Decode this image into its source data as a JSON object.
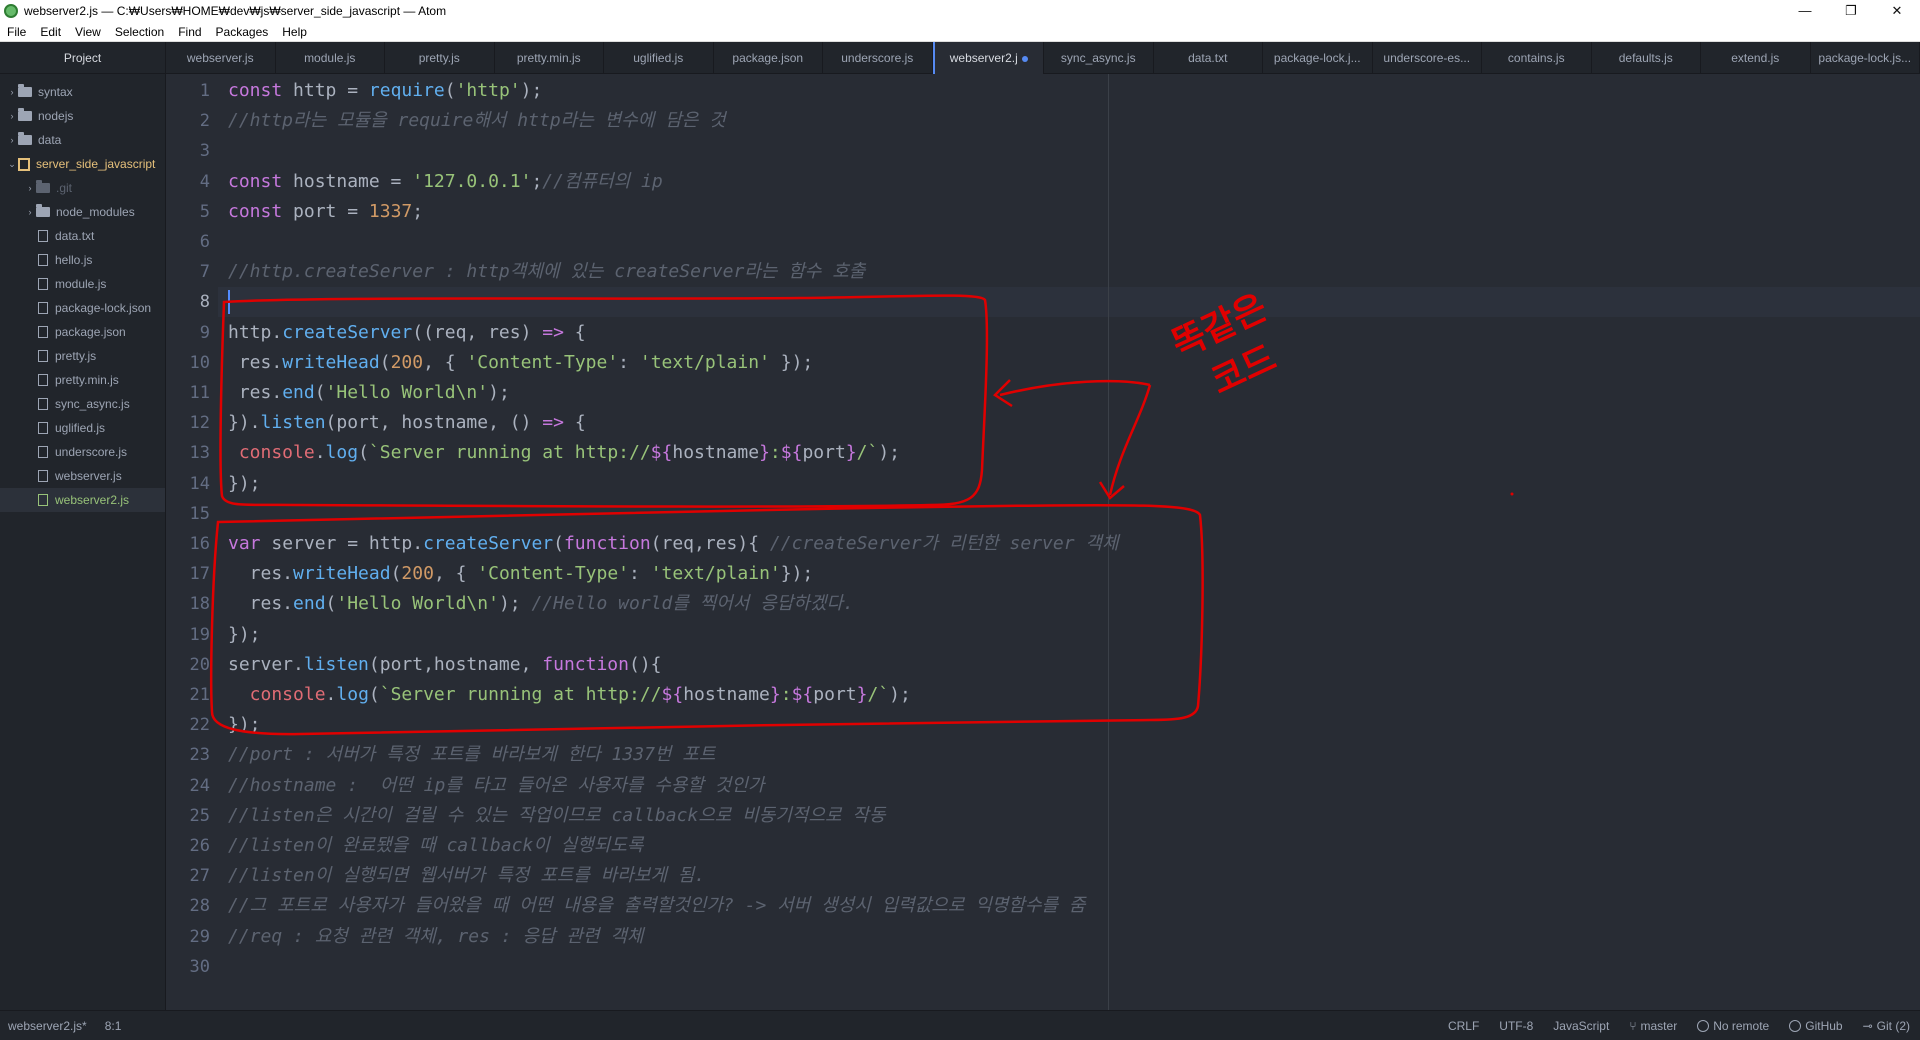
{
  "window": {
    "title": "webserver2.js — C:₩Users₩HOME₩dev₩js₩server_side_javascript — Atom",
    "controls": [
      "—",
      "❐",
      "✕"
    ]
  },
  "menu": [
    "File",
    "Edit",
    "View",
    "Selection",
    "Find",
    "Packages",
    "Help"
  ],
  "treeview": {
    "header": "Project",
    "items": [
      {
        "label": "syntax",
        "type": "folder",
        "expanded": false,
        "depth": 0
      },
      {
        "label": "nodejs",
        "type": "folder",
        "expanded": false,
        "depth": 0
      },
      {
        "label": "data",
        "type": "folder",
        "expanded": false,
        "depth": 0
      },
      {
        "label": "server_side_javascript",
        "type": "repo",
        "expanded": true,
        "depth": 0
      },
      {
        "label": ".git",
        "type": "folder",
        "expanded": false,
        "depth": 1
      },
      {
        "label": "node_modules",
        "type": "folder",
        "expanded": false,
        "depth": 1
      },
      {
        "label": "data.txt",
        "type": "file",
        "depth": 1
      },
      {
        "label": "hello.js",
        "type": "file",
        "depth": 1
      },
      {
        "label": "module.js",
        "type": "file",
        "depth": 1
      },
      {
        "label": "package-lock.json",
        "type": "file",
        "depth": 1
      },
      {
        "label": "package.json",
        "type": "file",
        "depth": 1
      },
      {
        "label": "pretty.js",
        "type": "file",
        "depth": 1
      },
      {
        "label": "pretty.min.js",
        "type": "file",
        "depth": 1
      },
      {
        "label": "sync_async.js",
        "type": "file",
        "depth": 1
      },
      {
        "label": "uglified.js",
        "type": "file",
        "depth": 1
      },
      {
        "label": "underscore.js",
        "type": "file",
        "depth": 1
      },
      {
        "label": "webserver.js",
        "type": "file",
        "depth": 1
      },
      {
        "label": "webserver2.js",
        "type": "file",
        "depth": 1,
        "selected": true
      }
    ]
  },
  "tabs": [
    {
      "label": "webserver.js"
    },
    {
      "label": "module.js"
    },
    {
      "label": "pretty.js"
    },
    {
      "label": "pretty.min.js"
    },
    {
      "label": "uglified.js"
    },
    {
      "label": "package.json"
    },
    {
      "label": "underscore.js"
    },
    {
      "label": "webserver2.j",
      "active": true,
      "modified": true
    },
    {
      "label": "sync_async.js"
    },
    {
      "label": "data.txt"
    },
    {
      "label": "package-lock.j..."
    },
    {
      "label": "underscore-es..."
    },
    {
      "label": "contains.js"
    },
    {
      "label": "defaults.js"
    },
    {
      "label": "extend.js"
    },
    {
      "label": "package-lock.js..."
    }
  ],
  "editor": {
    "cursor_line": 8,
    "lines": [
      [
        [
          "kw",
          "const"
        ],
        [
          "pun",
          " http = "
        ],
        [
          "fn",
          "require"
        ],
        [
          "pun",
          "("
        ],
        [
          "str",
          "'http'"
        ],
        [
          "pun",
          ");"
        ]
      ],
      [
        [
          "cm",
          "//http라는 모듈을 require해서 http라는 변수에 담은 것"
        ]
      ],
      [],
      [
        [
          "kw",
          "const"
        ],
        [
          "pun",
          " hostname = "
        ],
        [
          "str",
          "'127.0.0.1'"
        ],
        [
          "pun",
          ";"
        ],
        [
          "cm",
          "//컴퓨터의 ip"
        ]
      ],
      [
        [
          "kw",
          "const"
        ],
        [
          "pun",
          " port = "
        ],
        [
          "num",
          "1337"
        ],
        [
          "pun",
          ";"
        ]
      ],
      [],
      [
        [
          "cm",
          "//http.createServer : http객체에 있는 createServer라는 함수 호출"
        ]
      ],
      [],
      [
        [
          "pun",
          "http."
        ],
        [
          "fn",
          "createServer"
        ],
        [
          "pun",
          "((req, res) "
        ],
        [
          "kw",
          "=>"
        ],
        [
          "pun",
          " {"
        ]
      ],
      [
        [
          "pun",
          " res."
        ],
        [
          "fn",
          "writeHead"
        ],
        [
          "pun",
          "("
        ],
        [
          "num",
          "200"
        ],
        [
          "pun",
          ", { "
        ],
        [
          "str",
          "'Content-Type'"
        ],
        [
          "pun",
          ": "
        ],
        [
          "str",
          "'text/plain'"
        ],
        [
          "pun",
          " });"
        ]
      ],
      [
        [
          "pun",
          " res."
        ],
        [
          "fn",
          "end"
        ],
        [
          "pun",
          "("
        ],
        [
          "str",
          "'Hello World\\n'"
        ],
        [
          "pun",
          ");"
        ]
      ],
      [
        [
          "pun",
          "})."
        ],
        [
          "fn",
          "listen"
        ],
        [
          "pun",
          "(port, hostname, () "
        ],
        [
          "kw",
          "=>"
        ],
        [
          "pun",
          " {"
        ]
      ],
      [
        [
          "obj",
          " console"
        ],
        [
          "pun",
          "."
        ],
        [
          "fn",
          "log"
        ],
        [
          "pun",
          "("
        ],
        [
          "str",
          "`Server running at http://"
        ],
        [
          "kw",
          "${"
        ],
        [
          "pun",
          "hostname"
        ],
        [
          "kw",
          "}"
        ],
        [
          "str",
          ":"
        ],
        [
          "kw",
          "${"
        ],
        [
          "pun",
          "port"
        ],
        [
          "kw",
          "}"
        ],
        [
          "str",
          "/`"
        ],
        [
          "pun",
          ");"
        ]
      ],
      [
        [
          "pun",
          "});"
        ]
      ],
      [],
      [
        [
          "kw",
          "var"
        ],
        [
          "pun",
          " server = http."
        ],
        [
          "fn",
          "createServer"
        ],
        [
          "pun",
          "("
        ],
        [
          "kw",
          "function"
        ],
        [
          "pun",
          "(req,res){ "
        ],
        [
          "cm",
          "//createServer가 리턴한 server 객체"
        ]
      ],
      [
        [
          "pun",
          "  res."
        ],
        [
          "fn",
          "writeHead"
        ],
        [
          "pun",
          "("
        ],
        [
          "num",
          "200"
        ],
        [
          "pun",
          ", { "
        ],
        [
          "str",
          "'Content-Type'"
        ],
        [
          "pun",
          ": "
        ],
        [
          "str",
          "'text/plain'"
        ],
        [
          "pun",
          "});"
        ]
      ],
      [
        [
          "pun",
          "  res."
        ],
        [
          "fn",
          "end"
        ],
        [
          "pun",
          "("
        ],
        [
          "str",
          "'Hello World\\n'"
        ],
        [
          "pun",
          "); "
        ],
        [
          "cm",
          "//Hello world를 찍어서 응답하겠다."
        ]
      ],
      [
        [
          "pun",
          "});"
        ]
      ],
      [
        [
          "pun",
          "server."
        ],
        [
          "fn",
          "listen"
        ],
        [
          "pun",
          "(port,hostname, "
        ],
        [
          "kw",
          "function"
        ],
        [
          "pun",
          "(){"
        ]
      ],
      [
        [
          "obj",
          "  console"
        ],
        [
          "pun",
          "."
        ],
        [
          "fn",
          "log"
        ],
        [
          "pun",
          "("
        ],
        [
          "str",
          "`Server running at http://"
        ],
        [
          "kw",
          "${"
        ],
        [
          "pun",
          "hostname"
        ],
        [
          "kw",
          "}"
        ],
        [
          "str",
          ":"
        ],
        [
          "kw",
          "${"
        ],
        [
          "pun",
          "port"
        ],
        [
          "kw",
          "}"
        ],
        [
          "str",
          "/`"
        ],
        [
          "pun",
          ");"
        ]
      ],
      [
        [
          "pun",
          "});"
        ]
      ],
      [
        [
          "cm",
          "//port : 서버가 특정 포트를 바라보게 한다 1337번 포트"
        ]
      ],
      [
        [
          "cm",
          "//hostname :  어떤 ip를 타고 들어온 사용자를 수용할 것인가"
        ]
      ],
      [
        [
          "cm",
          "//listen은 시간이 걸릴 수 있는 작업이므로 callback으로 비동기적으로 작동"
        ]
      ],
      [
        [
          "cm",
          "//listen이 완료됐을 때 callback이 실행되도록"
        ]
      ],
      [
        [
          "cm",
          "//listen이 실행되면 웹서버가 특정 포트를 바라보게 됨."
        ]
      ],
      [
        [
          "cm",
          "//그 포트로 사용자가 들어왔을 때 어떤 내용을 출력할것인가? -> 서버 생성시 입력값으로 익명함수를 줌"
        ]
      ],
      [
        [
          "cm",
          "//req : 요청 관련 객체, res : 응답 관련 객체"
        ]
      ],
      []
    ]
  },
  "annotation": {
    "text_line1": "똑같은",
    "text_line2": "코드",
    "color": "#e00000"
  },
  "status": {
    "file": "webserver2.js*",
    "position": "8:1",
    "line_ending": "CRLF",
    "encoding": "UTF-8",
    "grammar": "JavaScript",
    "branch": "master",
    "remote": "No remote",
    "github": "GitHub",
    "git": "Git (2)"
  }
}
